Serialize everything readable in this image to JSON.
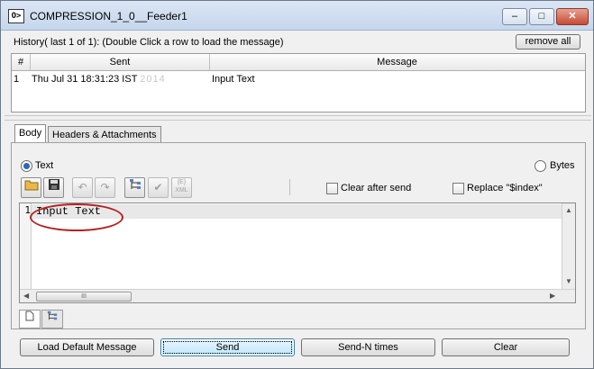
{
  "window": {
    "title": "COMPRESSION_1_0__Feeder1",
    "icon": "plug-icon"
  },
  "history": {
    "label": "History( last 1 of 1):   (Double Click a row to load the message)",
    "remove_all": "remove all",
    "columns": [
      "#",
      "Sent",
      "Message"
    ],
    "rows": [
      {
        "num": "1",
        "sent": "Thu Jul 31 18:31:23 IST",
        "sent_blur": "2014",
        "message": "Input Text"
      }
    ]
  },
  "tabs": [
    "Body",
    "Headers & Attachments"
  ],
  "body": {
    "radio_text": "Text",
    "radio_bytes": "Bytes",
    "clear_after_send": "Clear after send",
    "replace_index": "Replace \"$index\"",
    "xml_label_top": "{E}",
    "xml_label_bottom": "XML"
  },
  "editor": {
    "line_number": "1",
    "content": "Input Text",
    "scroll_thumb": "III"
  },
  "buttons": {
    "load_default": "Load Default Message",
    "send": "Send",
    "send_n": "Send-N times",
    "clear": "Clear"
  }
}
